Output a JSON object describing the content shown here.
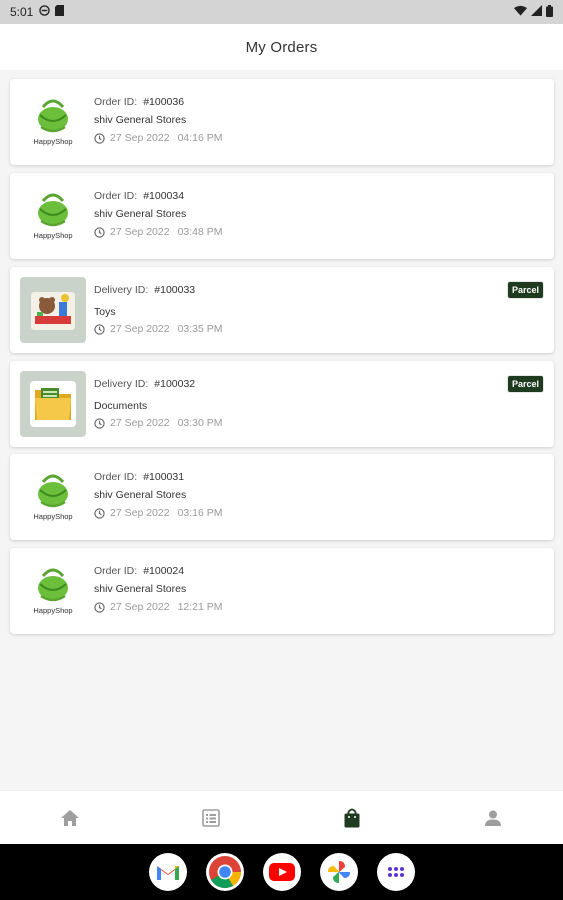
{
  "status_bar": {
    "time": "5:01"
  },
  "header": {
    "title": "My Orders"
  },
  "orders": [
    {
      "id_label": "Order ID:",
      "id": "#100036",
      "name": "shiv General Stores",
      "date": "27 Sep 2022",
      "time": "04:16 PM",
      "thumb": "happyshop",
      "thumb_text": "HappyShop",
      "badge": ""
    },
    {
      "id_label": "Order ID:",
      "id": "#100034",
      "name": "shiv General Stores",
      "date": "27 Sep 2022",
      "time": "03:48 PM",
      "thumb": "happyshop",
      "thumb_text": "HappyShop",
      "badge": ""
    },
    {
      "id_label": "Delivery ID:",
      "id": "#100033",
      "name": "Toys",
      "date": "27 Sep 2022",
      "time": "03:35 PM",
      "thumb": "toys",
      "thumb_text": "",
      "badge": "Parcel"
    },
    {
      "id_label": "Delivery ID:",
      "id": "#100032",
      "name": "Documents",
      "date": "27 Sep 2022",
      "time": "03:30 PM",
      "thumb": "documents",
      "thumb_text": "",
      "badge": "Parcel"
    },
    {
      "id_label": "Order ID:",
      "id": "#100031",
      "name": "shiv General Stores",
      "date": "27 Sep 2022",
      "time": "03:16 PM",
      "thumb": "happyshop",
      "thumb_text": "HappyShop",
      "badge": ""
    },
    {
      "id_label": "Order ID:",
      "id": "#100024",
      "name": "shiv General Stores",
      "date": "27 Sep 2022",
      "time": "12:21 PM",
      "thumb": "happyshop",
      "thumb_text": "HappyShop",
      "badge": ""
    }
  ],
  "bottom_nav": [
    {
      "icon": "home-icon",
      "active": false
    },
    {
      "icon": "list-icon",
      "active": false
    },
    {
      "icon": "shopping-bag-icon",
      "active": true
    },
    {
      "icon": "person-icon",
      "active": false
    }
  ],
  "dock": [
    {
      "icon": "gmail-icon"
    },
    {
      "icon": "chrome-icon"
    },
    {
      "icon": "youtube-icon"
    },
    {
      "icon": "photos-icon"
    },
    {
      "icon": "app-drawer-icon"
    }
  ],
  "colors": {
    "active_nav": "#1f3b1f",
    "inactive_nav": "#9e9e9e",
    "badge_bg": "#1f3b1f",
    "brand_green": "#5aa532"
  }
}
